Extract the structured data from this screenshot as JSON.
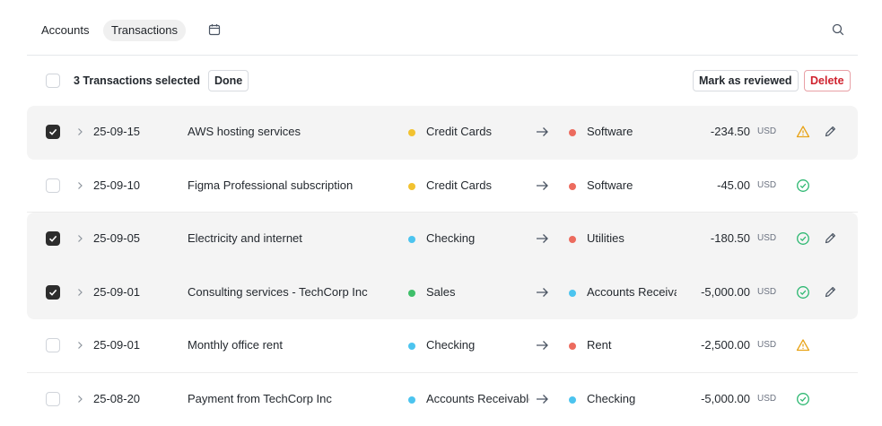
{
  "nav": {
    "tabs": [
      {
        "label": "Accounts"
      },
      {
        "label": "Transactions"
      }
    ]
  },
  "icons": {
    "calendar": "calendar-icon",
    "search": "search-icon"
  },
  "selection": {
    "text": "3 Transactions selected",
    "done_label": "Done",
    "review_label": "Mark as reviewed",
    "delete_label": "Delete"
  },
  "colors": {
    "yellow": "#f2c230",
    "red": "#ec6b5e",
    "blue": "#4cc4ef",
    "green": "#3fbf6a",
    "warning": "#e8a317",
    "ok": "#2eb872"
  },
  "transactions": [
    {
      "date": "25-09-15",
      "description": "AWS hosting services",
      "from": "Credit Cards",
      "from_color": "yellow",
      "to": "Software",
      "to_color": "red",
      "amount": "-234.50",
      "currency": "USD",
      "status": "warning",
      "selected": true
    },
    {
      "date": "25-09-10",
      "description": "Figma Professional subscription",
      "from": "Credit Cards",
      "from_color": "yellow",
      "to": "Software",
      "to_color": "red",
      "amount": "-45.00",
      "currency": "USD",
      "status": "ok",
      "selected": false
    },
    {
      "date": "25-09-05",
      "description": "Electricity and internet",
      "from": "Checking",
      "from_color": "blue",
      "to": "Utilities",
      "to_color": "red",
      "amount": "-180.50",
      "currency": "USD",
      "status": "ok",
      "selected": true
    },
    {
      "date": "25-09-01",
      "description": "Consulting services - TechCorp Inc",
      "from": "Sales",
      "from_color": "green",
      "to": "Accounts Receivable",
      "to_color": "blue",
      "amount": "-5,000.00",
      "currency": "USD",
      "status": "ok",
      "selected": true
    },
    {
      "date": "25-09-01",
      "description": "Monthly office rent",
      "from": "Checking",
      "from_color": "blue",
      "to": "Rent",
      "to_color": "red",
      "amount": "-2,500.00",
      "currency": "USD",
      "status": "warning",
      "selected": false
    },
    {
      "date": "25-08-20",
      "description": "Payment from TechCorp Inc",
      "from": "Accounts Receivable",
      "from_color": "blue",
      "to": "Checking",
      "to_color": "blue",
      "amount": "-5,000.00",
      "currency": "USD",
      "status": "ok",
      "selected": false
    }
  ]
}
